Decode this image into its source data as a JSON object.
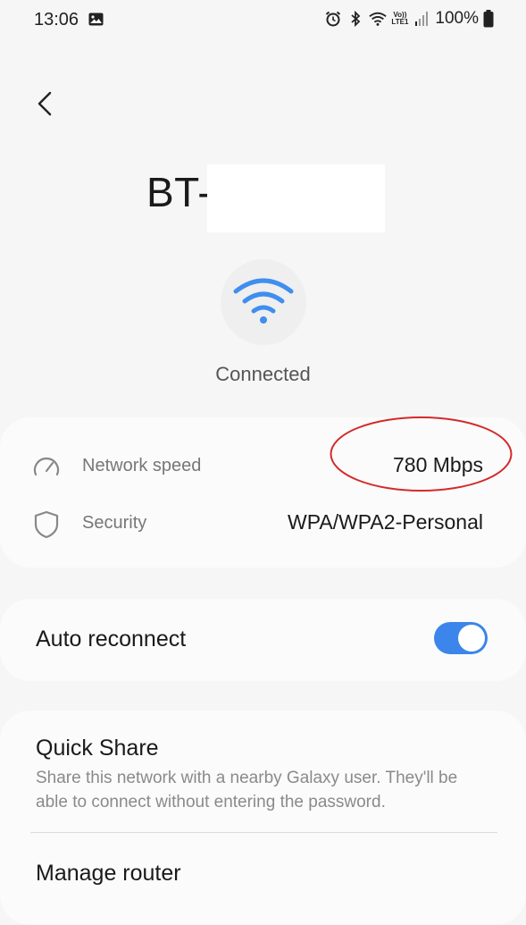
{
  "status_bar": {
    "time": "13:06",
    "battery": "100%",
    "volte_line1": "Vo))",
    "volte_line2": "LTE1",
    "icons": [
      "image-icon",
      "alarm-icon",
      "bluetooth-icon",
      "wifi-status-icon",
      "volte-icon",
      "signal-icon",
      "battery-icon"
    ]
  },
  "header": {
    "network_name": "BT-"
  },
  "connection": {
    "status": "Connected"
  },
  "info": {
    "network_speed_label": "Network speed",
    "network_speed_value": "780 Mbps",
    "security_label": "Security",
    "security_value": "WPA/WPA2-Personal"
  },
  "auto_reconnect": {
    "label": "Auto reconnect",
    "enabled": true
  },
  "quick_share": {
    "title": "Quick Share",
    "description": "Share this network with a nearby Galaxy user. They'll be able to connect without entering the password."
  },
  "manage_router": {
    "title": "Manage router"
  },
  "colors": {
    "accent": "#3c85ea",
    "wifi_icon": "#3f8ef0",
    "annotation": "#d42a2a"
  }
}
